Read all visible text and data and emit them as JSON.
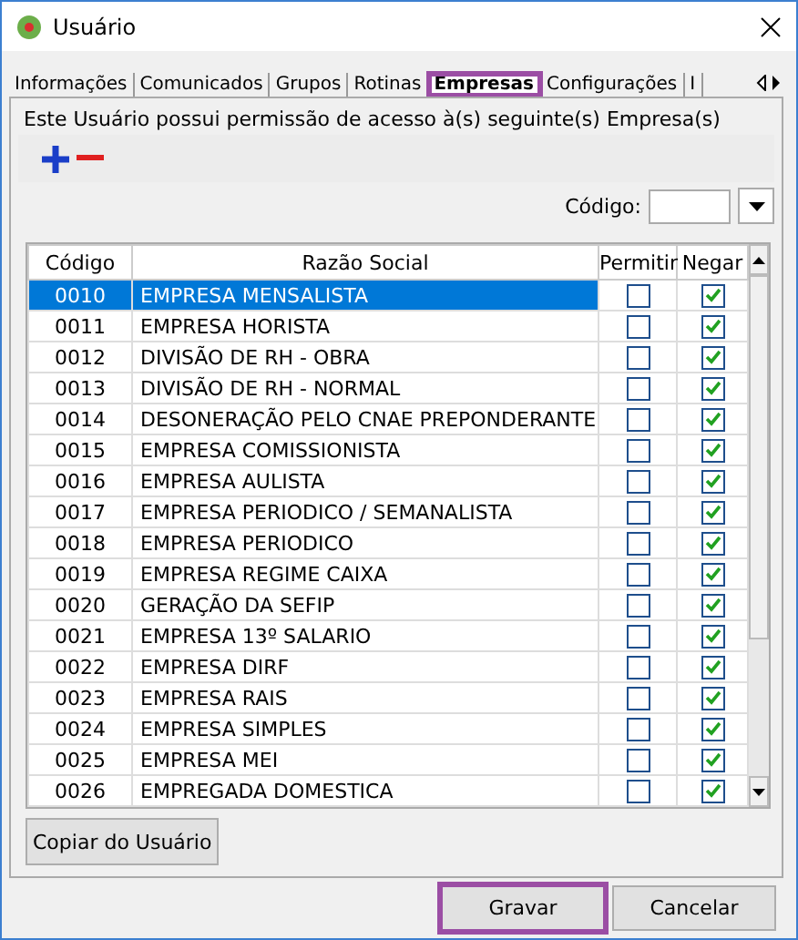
{
  "window": {
    "title": "Usuário"
  },
  "tabs": [
    {
      "label": "Informações",
      "selected": false,
      "highlighted": false
    },
    {
      "label": "Comunicados",
      "selected": false,
      "highlighted": false
    },
    {
      "label": "Grupos",
      "selected": false,
      "highlighted": false
    },
    {
      "label": "Rotinas",
      "selected": false,
      "highlighted": false
    },
    {
      "label": "Empresas",
      "selected": true,
      "highlighted": true
    },
    {
      "label": "Configurações",
      "selected": false,
      "highlighted": false
    },
    {
      "label": "I",
      "selected": false,
      "highlighted": false
    }
  ],
  "description": "Este Usuário possui permissão de acesso à(s) seguinte(s) Empresa(s)",
  "code_filter": {
    "label": "Código:"
  },
  "table": {
    "columns": [
      "Código",
      "Razão Social",
      "Permitir",
      "Negar"
    ],
    "rows": [
      {
        "code": "0010",
        "name": "EMPRESA MENSALISTA",
        "allow": false,
        "deny": true,
        "selected": true
      },
      {
        "code": "0011",
        "name": "EMPRESA HORISTA",
        "allow": false,
        "deny": true,
        "selected": false
      },
      {
        "code": "0012",
        "name": "DIVISÃO DE RH - OBRA",
        "allow": false,
        "deny": true,
        "selected": false
      },
      {
        "code": "0013",
        "name": "DIVISÃO DE RH - NORMAL",
        "allow": false,
        "deny": true,
        "selected": false
      },
      {
        "code": "0014",
        "name": "DESONERAÇÃO PELO CNAE PREPONDERANTE",
        "allow": false,
        "deny": true,
        "selected": false
      },
      {
        "code": "0015",
        "name": "EMPRESA COMISSIONISTA",
        "allow": false,
        "deny": true,
        "selected": false
      },
      {
        "code": "0016",
        "name": "EMPRESA AULISTA",
        "allow": false,
        "deny": true,
        "selected": false
      },
      {
        "code": "0017",
        "name": "EMPRESA PERIODICO / SEMANALISTA",
        "allow": false,
        "deny": true,
        "selected": false
      },
      {
        "code": "0018",
        "name": "EMPRESA PERIODICO",
        "allow": false,
        "deny": true,
        "selected": false
      },
      {
        "code": "0019",
        "name": "EMPRESA REGIME CAIXA",
        "allow": false,
        "deny": true,
        "selected": false
      },
      {
        "code": "0020",
        "name": "GERAÇÃO DA SEFIP",
        "allow": false,
        "deny": true,
        "selected": false
      },
      {
        "code": "0021",
        "name": "EMPRESA 13º SALARIO",
        "allow": false,
        "deny": true,
        "selected": false
      },
      {
        "code": "0022",
        "name": "EMPRESA DIRF",
        "allow": false,
        "deny": true,
        "selected": false
      },
      {
        "code": "0023",
        "name": "EMPRESA RAIS",
        "allow": false,
        "deny": true,
        "selected": false
      },
      {
        "code": "0024",
        "name": "EMPRESA SIMPLES",
        "allow": false,
        "deny": true,
        "selected": false
      },
      {
        "code": "0025",
        "name": "EMPRESA MEI",
        "allow": false,
        "deny": true,
        "selected": false
      },
      {
        "code": "0026",
        "name": "EMPREGADA DOMESTICA",
        "allow": false,
        "deny": true,
        "selected": false
      }
    ]
  },
  "copy_button": "Copiar do Usuário",
  "buttons": [
    {
      "label": "Gravar",
      "highlighted": true
    },
    {
      "label": "Cancelar",
      "highlighted": false
    }
  ]
}
